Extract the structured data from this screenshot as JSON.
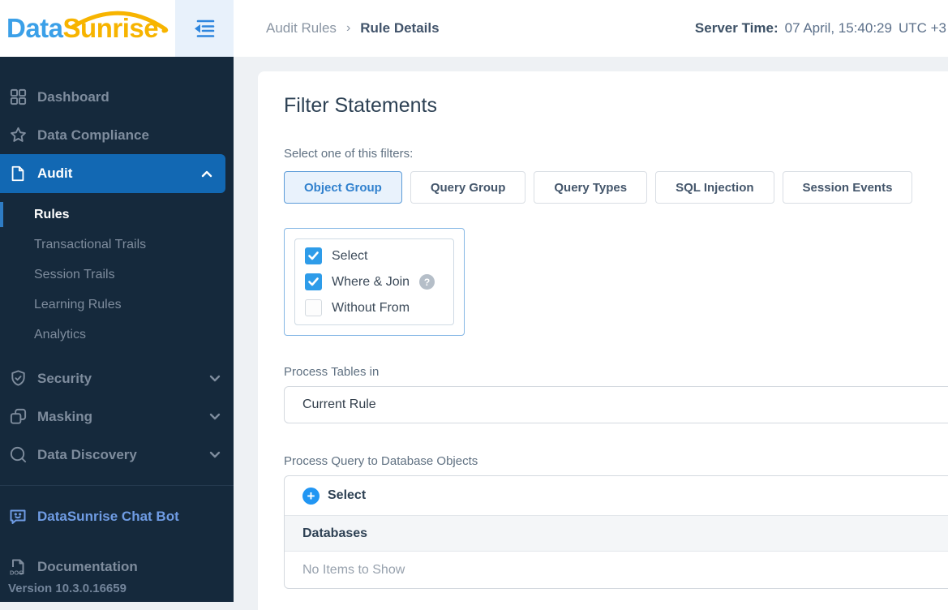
{
  "brand": {
    "word1": "Data",
    "word2": "Sunrise"
  },
  "topbar": {
    "breadcrumb": {
      "parent": "Audit Rules",
      "separator": "›",
      "current": "Rule Details"
    },
    "server_time": {
      "label": "Server Time:",
      "datetime": "07 April, 15:40:29",
      "timezone": "UTC +3"
    }
  },
  "colors": {
    "sidebar_bg": "#15293c",
    "active_item_blue": "#1268b3",
    "accent_blue": "#2e9ce9",
    "active_tab_text": "#3181ce",
    "logo_blue": "#3ba0e8",
    "logo_orange": "#f7b400",
    "chatbot_link_blue": "#6f9ce4"
  },
  "sidebar": {
    "items": [
      {
        "label": "Dashboard",
        "icon": "dashboard-grid-icon",
        "active": false
      },
      {
        "label": "Data Compliance",
        "icon": "star-icon",
        "active": false
      },
      {
        "label": "Audit",
        "icon": "document-icon",
        "active": true,
        "expanded": true
      },
      {
        "label": "Security",
        "icon": "shield-check-icon",
        "active": false,
        "expanded": false
      },
      {
        "label": "Masking",
        "icon": "masking-squares-icon",
        "active": false,
        "expanded": false
      },
      {
        "label": "Data Discovery",
        "icon": "magnifier-icon",
        "active": false,
        "expanded": false
      }
    ],
    "audit_subitems": [
      {
        "label": "Rules",
        "active": true
      },
      {
        "label": "Transactional Trails",
        "active": false
      },
      {
        "label": "Session Trails",
        "active": false
      },
      {
        "label": "Learning Rules",
        "active": false
      },
      {
        "label": "Analytics",
        "active": false
      }
    ],
    "footer_items": [
      {
        "label": "DataSunrise Chat Bot",
        "icon": "chat-bot-icon"
      },
      {
        "label": "Documentation",
        "icon": "doc-file-icon"
      }
    ],
    "version": "Version 10.3.0.16659"
  },
  "main": {
    "title": "Filter Statements",
    "filters_label": "Select one of this filters:",
    "filter_tabs": [
      {
        "label": "Object Group",
        "active": true
      },
      {
        "label": "Query Group",
        "active": false
      },
      {
        "label": "Query Types",
        "active": false
      },
      {
        "label": "SQL Injection",
        "active": false
      },
      {
        "label": "Session Events",
        "active": false
      }
    ],
    "statement_checkboxes": [
      {
        "label": "Select",
        "checked": true
      },
      {
        "label": "Where & Join",
        "checked": true,
        "help": "?"
      },
      {
        "label": "Without From",
        "checked": false
      }
    ],
    "process_tables": {
      "label": "Process Tables in",
      "value": "Current Rule"
    },
    "process_query": {
      "label": "Process Query to Database Objects",
      "select_button": "Select",
      "table_header": "Databases",
      "empty_text": "No Items to Show"
    }
  }
}
